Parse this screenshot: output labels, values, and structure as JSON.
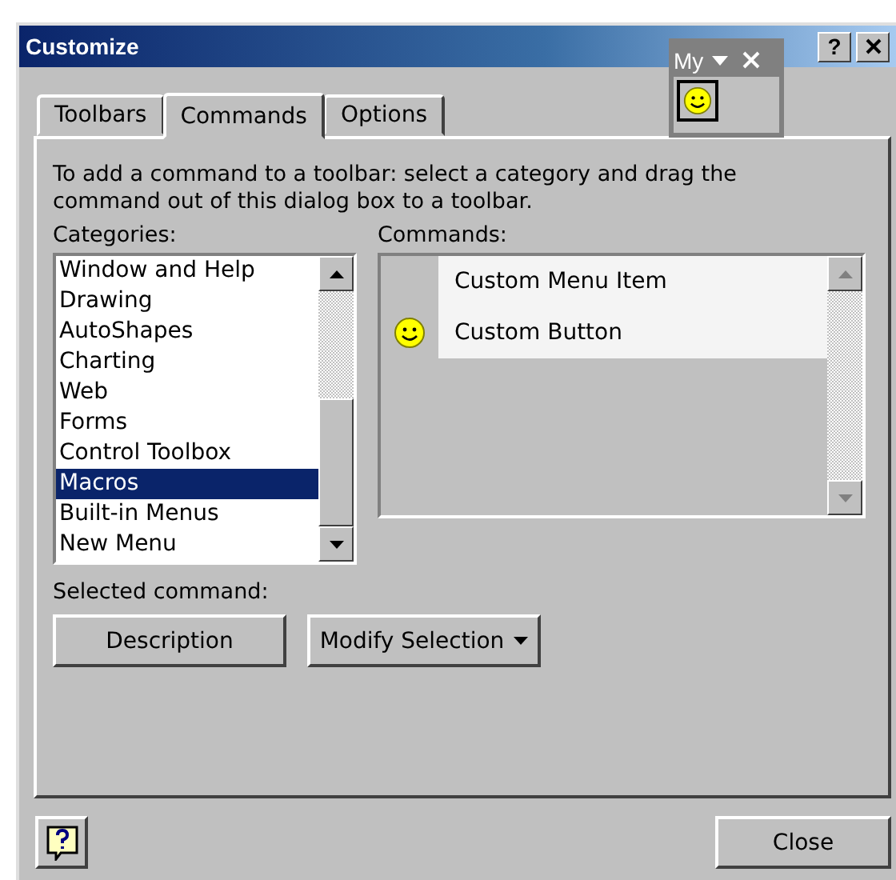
{
  "window": {
    "title": "Customize",
    "help_button": "?"
  },
  "floating_toolbar": {
    "title": "My"
  },
  "tabs": [
    {
      "label": "Toolbars",
      "selected": false
    },
    {
      "label": "Commands",
      "selected": true
    },
    {
      "label": "Options",
      "selected": false
    }
  ],
  "instructions": "To add a command to a toolbar: select a category and drag the command out of this dialog box to a toolbar.",
  "categories": {
    "label": "Categories:",
    "items": [
      {
        "label": "Window and Help",
        "selected": false
      },
      {
        "label": "Drawing",
        "selected": false
      },
      {
        "label": "AutoShapes",
        "selected": false
      },
      {
        "label": "Charting",
        "selected": false
      },
      {
        "label": "Web",
        "selected": false
      },
      {
        "label": "Forms",
        "selected": false
      },
      {
        "label": "Control Toolbox",
        "selected": false
      },
      {
        "label": "Macros",
        "selected": true
      },
      {
        "label": "Built-in Menus",
        "selected": false
      },
      {
        "label": "New Menu",
        "selected": false
      }
    ]
  },
  "commands": {
    "label": "Commands:",
    "items": [
      {
        "label": "Custom Menu Item",
        "kind": "menu_item"
      },
      {
        "label": "Custom Button",
        "kind": "button"
      }
    ]
  },
  "selected_command": {
    "label": "Selected command:",
    "buttons": [
      {
        "label": "Description",
        "kind": "plain"
      },
      {
        "label": "Modify Selection",
        "kind": "dropdown"
      }
    ]
  },
  "footer": {
    "close_button": "Close"
  }
}
